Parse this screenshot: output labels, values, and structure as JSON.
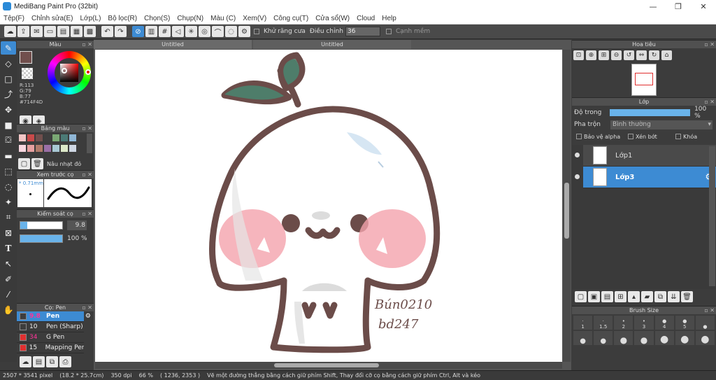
{
  "app": {
    "title": "MediBang Paint Pro (32bit)"
  },
  "window": {
    "minimize": "—",
    "restore": "❐",
    "close": "✕"
  },
  "menu": [
    "Tệp(F)",
    "Chỉnh sửa(E)",
    "Lớp(L)",
    "Bộ lọc(R)",
    "Chọn(S)",
    "Chụp(N)",
    "Màu (C)",
    "Xem(V)",
    "Công cụ(T)",
    "Cửa sổ(W)",
    "Cloud",
    "Help"
  ],
  "toolbar": {
    "antialias_label": "Khử răng cưa",
    "adjust_label": "Điều chỉnh",
    "adjust_value": "36",
    "smooth_label": "Cạnh mềm"
  },
  "panels": {
    "color": {
      "title": "Màu",
      "r": "R:113",
      "g": "G:79",
      "b": "B:77",
      "hex": "#714F4D",
      "main_color": "#714f4d"
    },
    "palette": {
      "title": "Bảng màu",
      "selected_name": "Nâu nhạt đỏ"
    },
    "brush_preview": {
      "title": "Xem trước cọ",
      "size": "* 0.71mm"
    },
    "brush_control": {
      "title": "Kiểm soát cọ",
      "size_value": "9.8",
      "opacity_value": "100 %",
      "size_fill": 0.16,
      "opacity_fill": 1.0
    },
    "brush_list": {
      "title": "Cọ: Pen",
      "items": [
        {
          "size": "9.8",
          "name": "Pen",
          "color": "#3d3d3d",
          "selected": true
        },
        {
          "size": "10",
          "name": "Pen (Sharp)",
          "color": "#3d3d3d",
          "selected": false
        },
        {
          "size": "34",
          "name": "G Pen",
          "color": "#e03030",
          "selected": false
        },
        {
          "size": "15",
          "name": "Mapping Pen",
          "color": "#e03030",
          "selected": false
        }
      ]
    },
    "navigator": {
      "title": "Hoa tiêu"
    },
    "layer": {
      "title": "Lớp",
      "opacity_label": "Độ trong",
      "opacity_value": "100 %",
      "blend_label": "Pha trộn",
      "blend_value": "Bình thường",
      "protect_alpha": "Bảo vệ alpha",
      "clipping": "Xén bớt",
      "lock": "Khóa",
      "layers": [
        {
          "name": "Lớp1",
          "selected": false
        },
        {
          "name": "Lớp3",
          "selected": true
        }
      ]
    },
    "brush_size": {
      "title": "Brush Size",
      "sizes": [
        "1",
        "1.5",
        "2",
        "3",
        "4",
        "5",
        ""
      ]
    }
  },
  "tabs": [
    {
      "label": "Untitled"
    },
    {
      "label": "Untitled"
    }
  ],
  "canvas": {
    "signature_line1": "Bún0210",
    "signature_line2": "bd247"
  },
  "status": {
    "size": "2507 * 3541 pixel",
    "physical": "(18.2 * 25.7cm)",
    "dpi": "350 dpi",
    "zoom": "66 %",
    "coords": "( 1236, 2353 )",
    "hint": "Vẽ một đường thẳng bằng cách giữ phím Shift, Thay đổi cỡ cọ bằng cách giữ phím Ctrl, Alt và kéo"
  }
}
